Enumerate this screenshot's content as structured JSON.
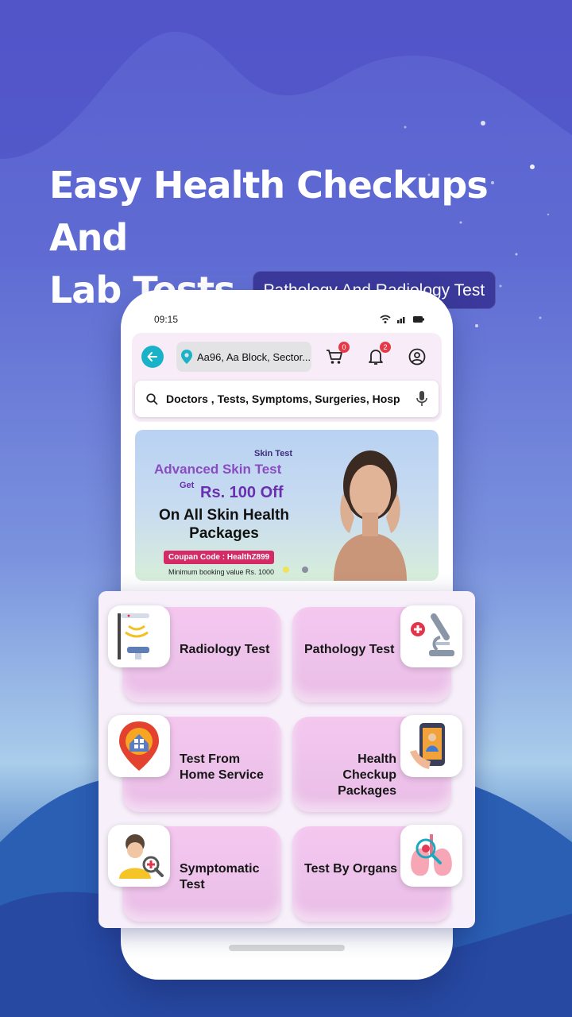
{
  "headline": {
    "line1": "Easy Health Checkups And",
    "line2": "Lab Tests",
    "pill": "Pathology And Radiology Test"
  },
  "status_bar": {
    "time": "09:15"
  },
  "app": {
    "location": "Aa96, Aa Block, Sector...",
    "cart_count": "0",
    "notification_count": "2",
    "search_placeholder": "Doctors , Tests, Symptoms, Surgeries, Hosp"
  },
  "banner": {
    "tag": "Skin Test",
    "title": "Advanced Skin Test",
    "get": "Get",
    "offer": "Rs. 100 Off",
    "subtitle": "On All Skin Health Packages",
    "coupon": "Coupan Code : HealthZ899",
    "min_booking": "Minimum booking value  Rs. 1000"
  },
  "services": [
    {
      "label_line1": "Radiology Test",
      "label_line2": ""
    },
    {
      "label_line1": "Pathology Test",
      "label_line2": ""
    },
    {
      "label_line1": "Test From",
      "label_line2": "Home Service"
    },
    {
      "label_line1": "Health Checkup",
      "label_line2": "Packages"
    },
    {
      "label_line1": "Symptomatic",
      "label_line2": "Test"
    },
    {
      "label_line1": "Test By Organs",
      "label_line2": ""
    }
  ],
  "colors": {
    "accent_teal": "#19b2c8",
    "pill_bg": "#3b3a9c",
    "tile_pink": "#f4c7ef",
    "coupon_red": "#d42a66"
  }
}
